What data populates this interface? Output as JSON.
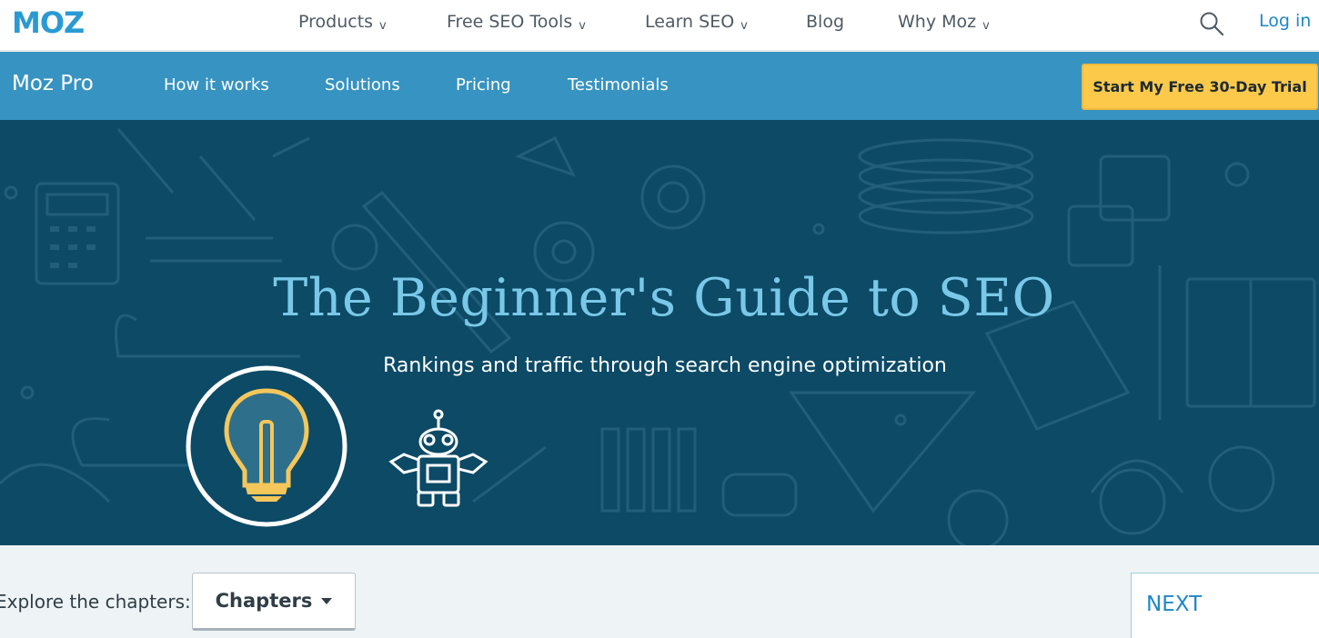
{
  "top_nav": {
    "logo_text": "MOZ",
    "items": [
      {
        "label": "Products",
        "caret": "v"
      },
      {
        "label": "Free SEO Tools",
        "caret": "v"
      },
      {
        "label": "Learn SEO",
        "caret": "v"
      },
      {
        "label": "Blog",
        "caret": ""
      },
      {
        "label": "Why Moz",
        "caret": "v"
      }
    ],
    "search_icon": "search-icon",
    "login_label": "Log in"
  },
  "sub_nav": {
    "brand": "Moz Pro",
    "items": [
      "How it works",
      "Solutions",
      "Pricing",
      "Testimonials"
    ],
    "cta_label": "Start My Free 30-Day Trial"
  },
  "hero": {
    "title": "The Beginner's Guide to SEO",
    "subtitle": "Rankings and traffic through search engine optimization",
    "icons": [
      "lightbulb-icon",
      "robot-icon"
    ]
  },
  "chapter_bar": {
    "explore_label": "Explore the chapters:",
    "chapters_label": "Chapters",
    "next_label": "NEXT"
  },
  "colors": {
    "brand_blue": "#1e86c8",
    "subnav_blue": "#3793c1",
    "hero_bg": "#0c4a66",
    "hero_title": "#79c8e8",
    "cta_yellow": "#fcc94a",
    "bulb_yellow": "#f5c75a"
  }
}
